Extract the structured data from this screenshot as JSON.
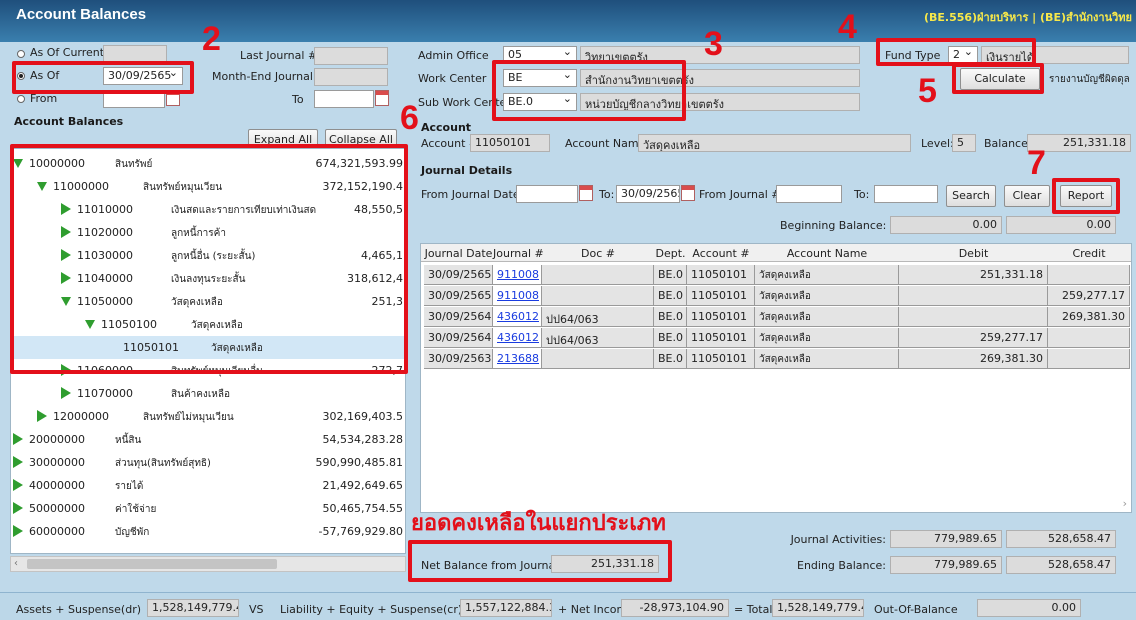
{
  "title": "Account Balances",
  "header_right": "(BE.556)ฝ่ายบริหาร | (BE)สำนักงานวิทย",
  "date_options": {
    "as_of_current_label": "As Of Current",
    "as_of_label": "As Of",
    "as_of_value": "30/09/2565",
    "from_label": "From",
    "to_label": "To",
    "last_journal_label": "Last Journal #",
    "month_end_journal_label": "Month-End Journal #"
  },
  "admin": {
    "admin_office_label": "Admin Office",
    "admin_office_code": "05",
    "admin_office_name": "วิทยาเขตตรัง",
    "work_center_label": "Work Center",
    "work_center_code": "BE",
    "work_center_name": "สำนักงานวิทยาเขตตรัง",
    "sub_work_center_label": "Sub Work Center",
    "sub_work_center_code": "BE.0",
    "sub_work_center_name": "หน่วยบัญชีกลางวิทยาเขตตรัง"
  },
  "fund": {
    "fund_type_label": "Fund Type",
    "fund_type_code": "2",
    "fund_type_name": "เงินรายได้",
    "calculate_label": "Calculate",
    "report_link": "รายงานบัญชีผิดดุล"
  },
  "account_balances": {
    "heading": "Account Balances",
    "expand_all": "Expand All",
    "collapse_all": "Collapse All",
    "tree": [
      {
        "code": "10000000",
        "name": "สินทรัพย์",
        "amount": "674,321,593.99",
        "indent": 0,
        "state": "open"
      },
      {
        "code": "11000000",
        "name": "สินทรัพย์หมุนเวียน",
        "amount": "372,152,190.4",
        "indent": 1,
        "state": "open"
      },
      {
        "code": "11010000",
        "name": "เงินสดและรายการเทียบเท่าเงินสด",
        "amount": "48,550,5",
        "indent": 2,
        "state": "closed"
      },
      {
        "code": "11020000",
        "name": "ลูกหนี้การค้า",
        "amount": "",
        "indent": 2,
        "state": "closed"
      },
      {
        "code": "11030000",
        "name": "ลูกหนี้อื่น (ระยะสั้น)",
        "amount": "4,465,1",
        "indent": 2,
        "state": "closed"
      },
      {
        "code": "11040000",
        "name": "เงินลงทุนระยะสั้น",
        "amount": "318,612,4",
        "indent": 2,
        "state": "closed"
      },
      {
        "code": "11050000",
        "name": "วัสดุคงเหลือ",
        "amount": "251,3",
        "indent": 2,
        "state": "open"
      },
      {
        "code": "11050100",
        "name": "วัสดุคงเหลือ",
        "amount": "",
        "indent": 3,
        "state": "open"
      },
      {
        "code": "11050101",
        "name": "วัสดุคงเหลือ",
        "amount": "",
        "indent": 4,
        "state": "leaf"
      },
      {
        "code": "11060000",
        "name": "สินทรัพย์หมุนเวียนอื่น",
        "amount": "272,7",
        "indent": 2,
        "state": "closed"
      },
      {
        "code": "11070000",
        "name": "สินค้าคงเหลือ",
        "amount": "",
        "indent": 2,
        "state": "closed"
      },
      {
        "code": "12000000",
        "name": "สินทรัพย์ไม่หมุนเวียน",
        "amount": "302,169,403.5",
        "indent": 1,
        "state": "closed"
      },
      {
        "code": "20000000",
        "name": "หนี้สิน",
        "amount": "54,534,283.28",
        "indent": 0,
        "state": "closed"
      },
      {
        "code": "30000000",
        "name": "ส่วนทุน(สินทรัพย์สุทธิ)",
        "amount": "590,990,485.81",
        "indent": 0,
        "state": "closed"
      },
      {
        "code": "40000000",
        "name": "รายได้",
        "amount": "21,492,649.65",
        "indent": 0,
        "state": "closed"
      },
      {
        "code": "50000000",
        "name": "ค่าใช้จ่าย",
        "amount": "50,465,754.55",
        "indent": 0,
        "state": "closed"
      },
      {
        "code": "60000000",
        "name": "บัญชีพัก",
        "amount": "-57,769,929.80",
        "indent": 0,
        "state": "closed"
      }
    ]
  },
  "account": {
    "heading": "Account",
    "account_no_label": "Account #",
    "account_no": "11050101",
    "account_name_label": "Account Name:",
    "account_name": "วัสดุคงเหลือ",
    "level_label": "Level:",
    "level": "5",
    "balance_label": "Balance:",
    "balance": "251,331.18"
  },
  "journal": {
    "heading": "Journal Details",
    "from_date_label": "From Journal Date:",
    "to_label": "To:",
    "to_date": "30/09/2565",
    "from_journal_label": "From Journal #:",
    "to2_label": "To:",
    "search": "Search",
    "clear": "Clear",
    "report": "Report",
    "beginning_balance_label": "Beginning Balance:",
    "beginning_debit": "0.00",
    "beginning_credit": "0.00",
    "columns": [
      "Journal Date",
      "Journal #",
      "Doc #",
      "Dept.",
      "Account #",
      "Account Name",
      "Debit",
      "Credit"
    ],
    "rows": [
      {
        "date": "30/09/2565",
        "journal": "911008",
        "doc": "",
        "dept": "BE.0",
        "account": "11050101",
        "name": "วัสดุคงเหลือ",
        "debit": "251,331.18",
        "credit": ""
      },
      {
        "date": "30/09/2565",
        "journal": "911008",
        "doc": "",
        "dept": "BE.0",
        "account": "11050101",
        "name": "วัสดุคงเหลือ",
        "debit": "",
        "credit": "259,277.17"
      },
      {
        "date": "30/09/2564",
        "journal": "436012",
        "doc": "ปป64/063",
        "dept": "BE.0",
        "account": "11050101",
        "name": "วัสดุคงเหลือ",
        "debit": "",
        "credit": "269,381.30"
      },
      {
        "date": "30/09/2564",
        "journal": "436012",
        "doc": "ปป64/063",
        "dept": "BE.0",
        "account": "11050101",
        "name": "วัสดุคงเหลือ",
        "debit": "259,277.17",
        "credit": ""
      },
      {
        "date": "30/09/2563",
        "journal": "213688",
        "doc": "",
        "dept": "BE.0",
        "account": "11050101",
        "name": "วัสดุคงเหลือ",
        "debit": "269,381.30",
        "credit": ""
      }
    ],
    "journal_activities_label": "Journal Activities:",
    "activities_debit": "779,989.65",
    "activities_credit": "528,658.47",
    "ending_balance_label": "Ending Balance:",
    "ending_debit": "779,989.65",
    "ending_credit": "528,658.47",
    "net_balance_label": "Net Balance from Journals:",
    "net_balance": "251,331.18"
  },
  "caption": "ยอดคงเหลือในแยกประเภท",
  "markers": [
    "2",
    "3",
    "4",
    "5",
    "6",
    "7"
  ],
  "footer": {
    "assets_label": "Assets + Suspense(dr)",
    "assets_value": "1,528,149,779.41",
    "vs": "VS",
    "liab_label": "Liability + Equity + Suspense(cr)",
    "liab_value": "1,557,122,884.31",
    "net_income_label": "+ Net Income",
    "net_income_value": "-28,973,104.90",
    "total_label": "= Total",
    "total_value": "1,528,149,779.41",
    "oob_label": "Out-Of-Balance",
    "oob_value": "0.00"
  },
  "colors": {
    "annotation_red": "#e3101a",
    "tree_arrow_green": "#2f9d2f",
    "link_blue": "#1a3ce0",
    "header_yellow": "#f7e84a"
  }
}
